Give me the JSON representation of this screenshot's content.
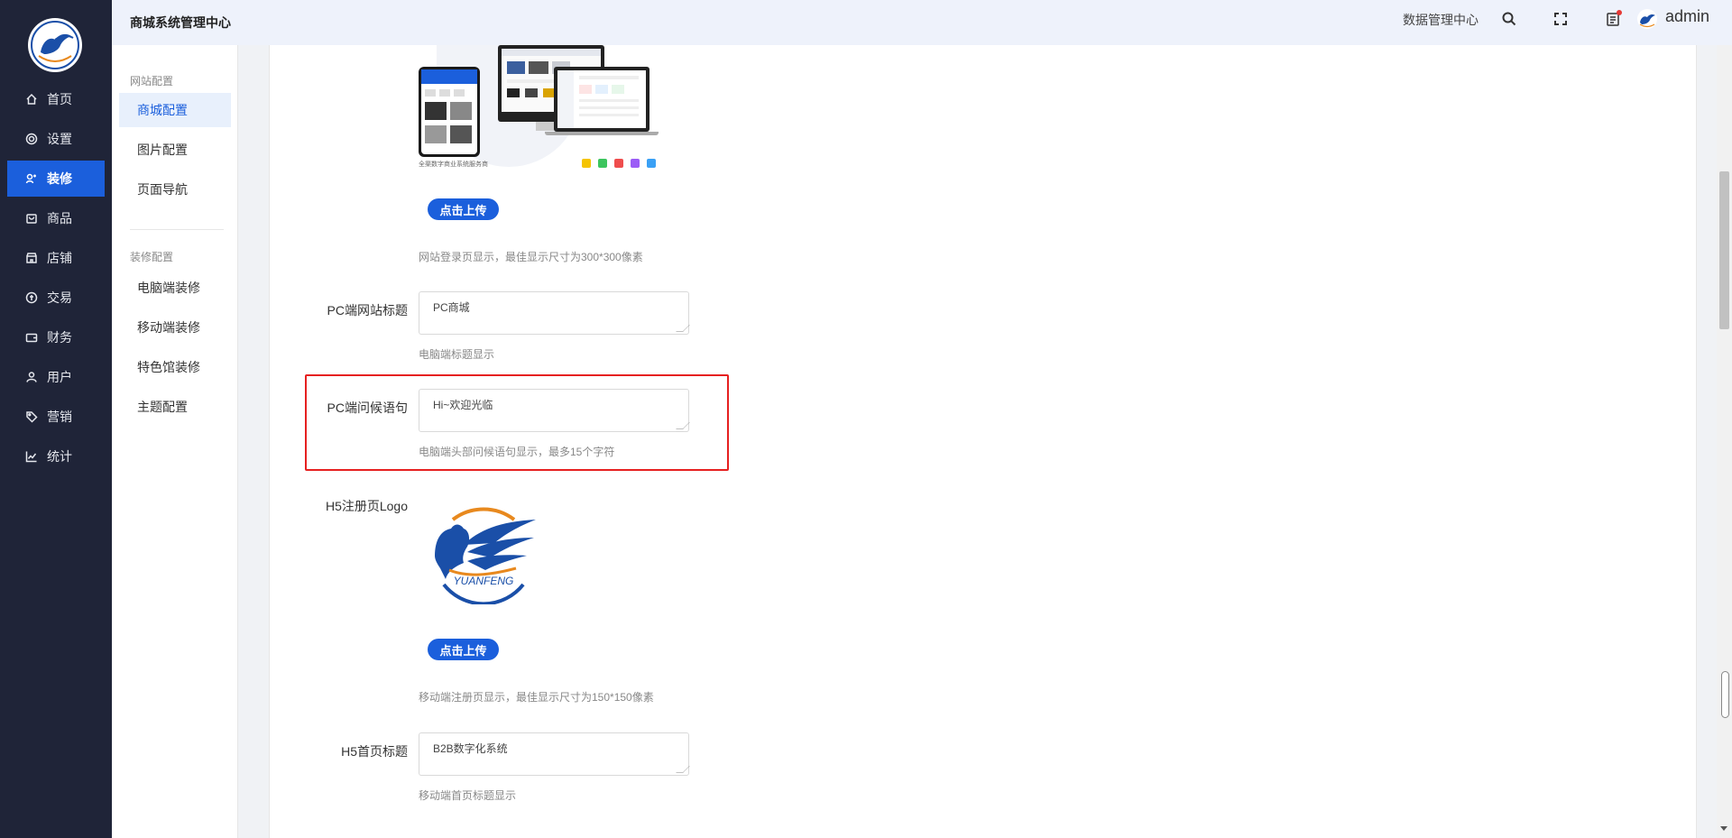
{
  "nav": {
    "items": [
      {
        "label": "首页",
        "icon": "home-icon"
      },
      {
        "label": "设置",
        "icon": "gear-icon"
      },
      {
        "label": "装修",
        "icon": "brush-icon",
        "active": true
      },
      {
        "label": "商品",
        "icon": "box-icon"
      },
      {
        "label": "店铺",
        "icon": "shop-icon"
      },
      {
        "label": "交易",
        "icon": "exchange-icon"
      },
      {
        "label": "财务",
        "icon": "wallet-icon"
      },
      {
        "label": "用户",
        "icon": "user-icon"
      },
      {
        "label": "营销",
        "icon": "tag-icon"
      },
      {
        "label": "统计",
        "icon": "chart-icon"
      }
    ]
  },
  "header": {
    "title": "商城系统管理中心",
    "data_center": "数据管理中心",
    "username": "admin"
  },
  "subnav": {
    "group1": "网站配置",
    "group1_items": [
      "商城配置",
      "图片配置",
      "页面导航"
    ],
    "group2": "装修配置",
    "group2_items": [
      "电脑端装修",
      "移动端装修",
      "特色馆装修",
      "主题配置"
    ]
  },
  "form": {
    "mock_caption": "全渠数字商业系统服务商",
    "upload_label": "点击上传",
    "login_logo_hint": "网站登录页显示，最佳显示尺寸为300*300像素",
    "pc_title_label": "PC端网站标题",
    "pc_title_value": "PC商城",
    "pc_title_hint": "电脑端标题显示",
    "pc_greeting_label": "PC端问候语句",
    "pc_greeting_value": "Hi~欢迎光临",
    "pc_greeting_hint": "电脑端头部问候语句显示，最多15个字符",
    "h5_logo_label": "H5注册页Logo",
    "h5_logo_text": "YUANFENG",
    "h5_upload_label": "点击上传",
    "h5_logo_hint": "移动端注册页显示，最佳显示尺寸为150*150像素",
    "h5_title_label": "H5首页标题",
    "h5_title_value": "B2B数字化系统",
    "h5_title_hint": "移动端首页标题显示"
  },
  "colors": {
    "sidebar_bg": "#1f2438",
    "accent": "#1b5fdc",
    "highlight": "#e62020",
    "logo_orange": "#e8891e"
  }
}
